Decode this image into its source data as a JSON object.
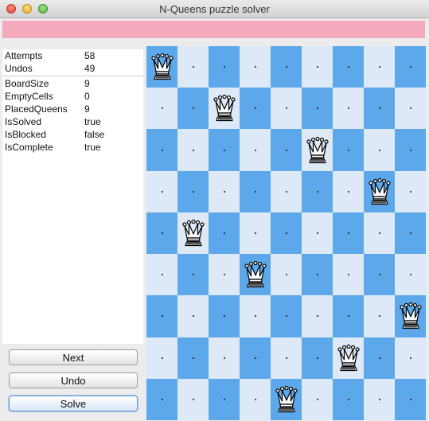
{
  "window": {
    "title": "N-Queens puzzle solver"
  },
  "stats": {
    "group1": [
      {
        "key": "Attempts",
        "value": "58"
      },
      {
        "key": "Undos",
        "value": "49"
      }
    ],
    "group2": [
      {
        "key": "BoardSize",
        "value": "9"
      },
      {
        "key": "EmptyCells",
        "value": "0"
      },
      {
        "key": "PlacedQueens",
        "value": "9"
      },
      {
        "key": "IsSolved",
        "value": "true"
      },
      {
        "key": "IsBlocked",
        "value": "false"
      },
      {
        "key": "IsComplete",
        "value": "true"
      }
    ]
  },
  "buttons": {
    "next": "Next",
    "undo": "Undo",
    "solve": "Solve"
  },
  "board": {
    "size": 9,
    "queen_columns_by_row": [
      0,
      2,
      5,
      7,
      1,
      3,
      8,
      6,
      4
    ],
    "colors": {
      "light": "#dde9f6",
      "dark": "#5da8ea"
    },
    "queen_icon": "white-queen-icon",
    "empty_marker": "dot"
  }
}
